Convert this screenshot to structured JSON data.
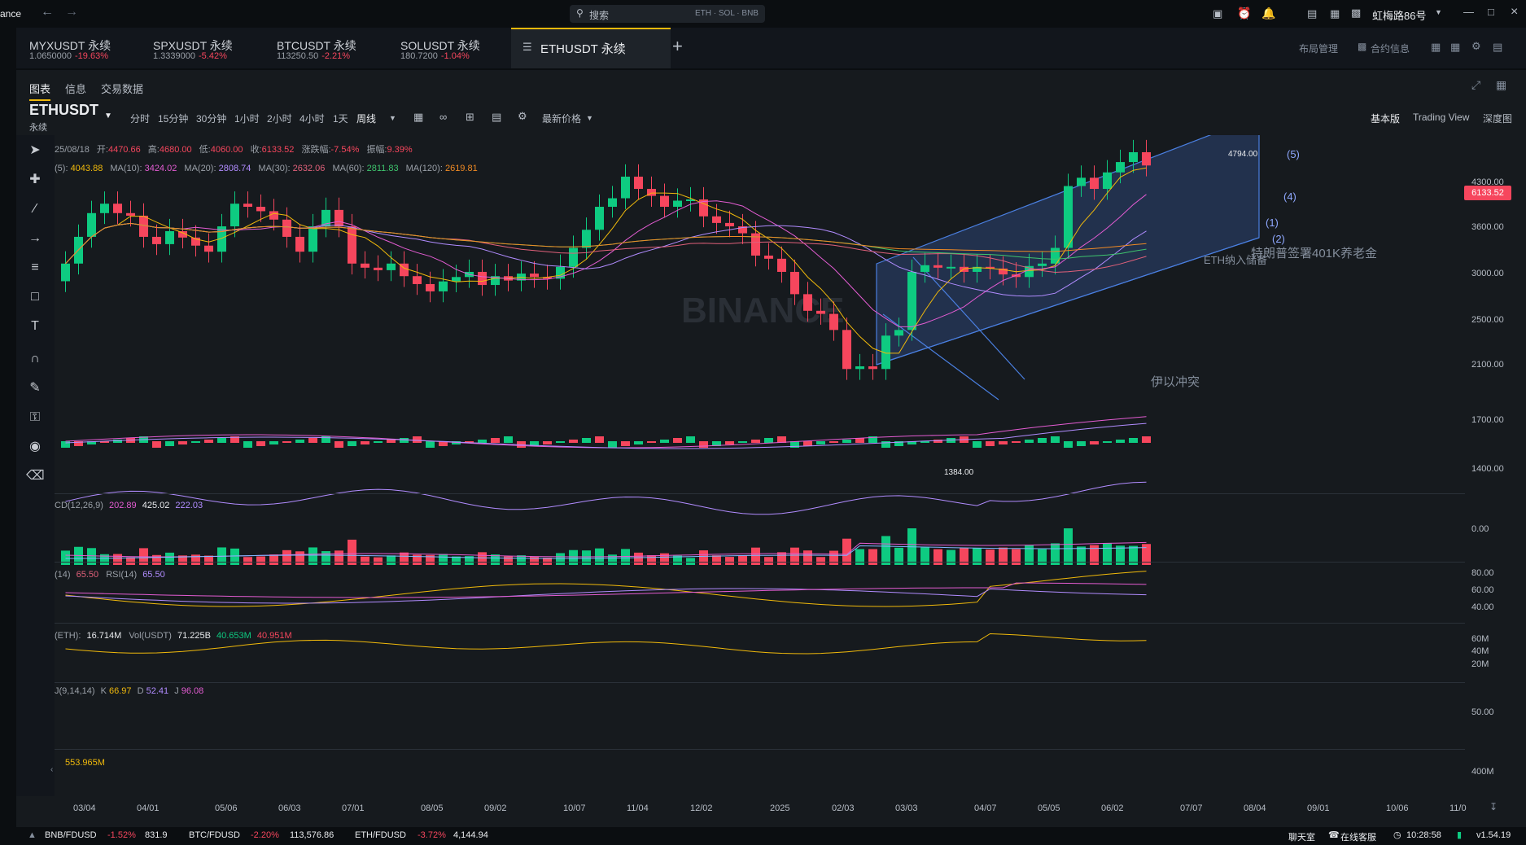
{
  "titlebar": {
    "app_fragment": "ance",
    "search_placeholder": "搜索",
    "search_hints": "ETH · SOL · BNB",
    "user": "虹梅路86号"
  },
  "tabs": [
    {
      "symbol": "MYXUSDT 永续",
      "price": "1.0650000",
      "change": "-19.63%"
    },
    {
      "symbol": "SPXUSDT 永续",
      "price": "1.3339000",
      "change": "-5.42%"
    },
    {
      "symbol": "BTCUSDT 永续",
      "price": "113250.50",
      "change": "-2.21%"
    },
    {
      "symbol": "SOLUSDT 永续",
      "price": "180.7200",
      "change": "-1.04%"
    },
    {
      "symbol": "ETHUSDT 永续",
      "price": "",
      "change": ""
    }
  ],
  "tabbar_right": {
    "layout": "布局管理",
    "contract_info": "合约信息"
  },
  "subtabs": {
    "chart": "图表",
    "info": "信息",
    "trading_data": "交易数据"
  },
  "symbol": {
    "name": "ETHUSDT",
    "type": "永续"
  },
  "intervals": [
    "分时",
    "15分钟",
    "30分钟",
    "1小时",
    "2小时",
    "4小时",
    "1天",
    "周线"
  ],
  "price_type": "最新价格",
  "view_modes": {
    "basic": "基本版",
    "tradingview": "Trading View",
    "depth": "深度图"
  },
  "ohlc": {
    "date": "25/08/18",
    "open_label": "开:",
    "open": "4470.66",
    "high_label": "高:",
    "high": "4680.00",
    "low_label": "低:",
    "low": "4060.00",
    "close_label": "收:",
    "close": "6133.52",
    "chg_label": "涨跌幅:",
    "chg": "-7.54%",
    "amp_label": "振幅:",
    "amp": "9.39%"
  },
  "ma_legend": [
    {
      "label": "(5):",
      "value": "4043.88",
      "color": "#f0b90b"
    },
    {
      "label": "MA(10):",
      "value": "3424.02",
      "color": "#e35cd2"
    },
    {
      "label": "MA(20):",
      "value": "2808.74",
      "color": "#b18cff"
    },
    {
      "label": "MA(30):",
      "value": "2632.06",
      "color": "#e0607a"
    },
    {
      "label": "MA(60):",
      "value": "2811.83",
      "color": "#3ec46d"
    },
    {
      "label": "MA(120):",
      "value": "2619.81",
      "color": "#f08a24"
    }
  ],
  "price_axis": [
    "4300.00",
    "3600.00",
    "3000.00",
    "2500.00",
    "2100.00",
    "1700.00",
    "1400.00"
  ],
  "current_price": "6133.52",
  "annotations": {
    "high": "4794.00",
    "low": "1384.00",
    "event1": "伊以冲突",
    "event2": "特朗普签署401K养老金",
    "event3": "ETH纳入储备",
    "waves": [
      "(5)",
      "(4)",
      "(1)",
      "(2)"
    ]
  },
  "macd": {
    "label": "CD(12,26,9)",
    "v1": "202.89",
    "v2": "425.02",
    "v3": "222.03",
    "axis": "0.00"
  },
  "rsi": {
    "label1": "(14)",
    "v1": "65.50",
    "label2": "RSI(14)",
    "v2": "65.50",
    "axis": [
      "80.00",
      "60.00",
      "40.00"
    ]
  },
  "vol": {
    "label": "(ETH):",
    "v1": "16.714M",
    "label2": "Vol(USDT)",
    "v2": "71.225B",
    "v3": "40.653M",
    "v4": "40.951M",
    "axis": [
      "60M",
      "40M",
      "20M"
    ]
  },
  "kdj": {
    "label": "J(9,14,14)",
    "k_label": "K",
    "k": "66.97",
    "d_label": "D",
    "d": "52.41",
    "j_label": "J",
    "j": "96.08",
    "axis": "50.00"
  },
  "obv": {
    "value": "553.965M",
    "axis": "400M"
  },
  "dates": [
    "03/04",
    "04/01",
    "05/06",
    "06/03",
    "07/01",
    "08/05",
    "09/02",
    "10/07",
    "11/04",
    "12/02",
    "2025",
    "02/03",
    "03/03",
    "04/07",
    "05/05",
    "06/02",
    "07/07",
    "08/04",
    "09/01",
    "10/06",
    "11/0"
  ],
  "watermark": "BINANCE",
  "statusbar": {
    "pairs": [
      {
        "name": "BNB/FDUSD",
        "chg": "-1.52%",
        "price": "831.9"
      },
      {
        "name": "BTC/FDUSD",
        "chg": "-2.20%",
        "price": "113,576.86"
      },
      {
        "name": "ETH/FDUSD",
        "chg": "-3.72%",
        "price": "4,144.94"
      }
    ],
    "chat": "聊天室",
    "service": "在线客服",
    "time": "10:28:58",
    "version": "v1.54.19"
  },
  "chart_data": {
    "type": "candlestick",
    "timeframe": "weekly",
    "candles_close": [
      2600,
      2950,
      3300,
      3450,
      3300,
      3260,
      2950,
      2850,
      3030,
      2940,
      2830,
      2750,
      3100,
      3450,
      3400,
      3330,
      3200,
      2950,
      2750,
      3100,
      3350,
      3100,
      2600,
      2550,
      2520,
      2600,
      2450,
      2360,
      2280,
      2390,
      2440,
      2500,
      2350,
      2450,
      2400,
      2480,
      2440,
      2420,
      2560,
      2800,
      3050,
      3400,
      3540,
      3920,
      3700,
      3580,
      3400,
      3500,
      3520,
      3250,
      3150,
      3100,
      3000,
      2700,
      2660,
      2500,
      2250,
      2080,
      2050,
      1900,
      1580,
      1600,
      1580,
      1850,
      1900,
      2500,
      2580,
      2550,
      2560,
      2500,
      2560,
      2540,
      2470,
      2440,
      2570,
      2600,
      2800,
      3750,
      3900,
      3700,
      4000,
      4200,
      4400,
      4133
    ]
  }
}
